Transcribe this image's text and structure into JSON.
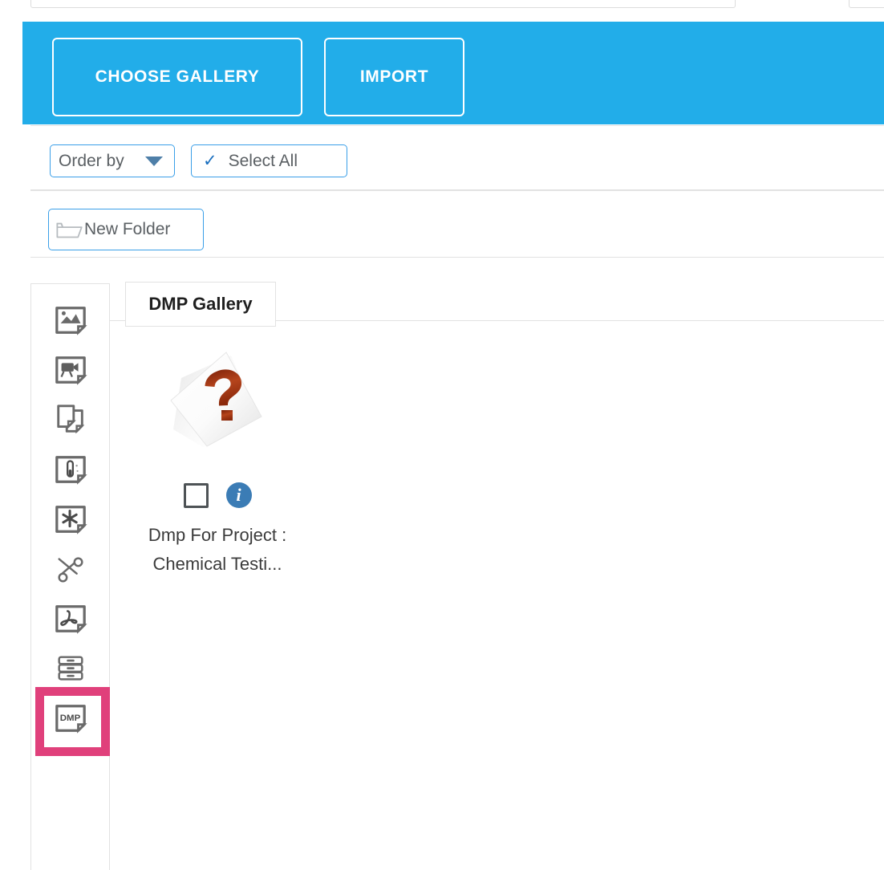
{
  "top_stubs": [
    {
      "name": "upper-field-left"
    },
    {
      "name": "upper-field-right"
    }
  ],
  "action_bar": {
    "background_color": "#22ADE9",
    "buttons": [
      {
        "label": "CHOOSE GALLERY",
        "name": "choose-gallery-button"
      },
      {
        "label": "IMPORT",
        "name": "import-button"
      }
    ]
  },
  "toolbar": {
    "order_by_label": "Order by",
    "select_all_label": "Select All",
    "select_all_check": "✓",
    "accent_color": "#3A9FE8"
  },
  "folder_bar": {
    "new_folder_label": "New Folder"
  },
  "sidebar": {
    "items": [
      {
        "label": "Images",
        "icon": "image-file-icon"
      },
      {
        "label": "Videos",
        "icon": "video-file-icon"
      },
      {
        "label": "Documents",
        "icon": "documents-icon"
      },
      {
        "label": "Chemistry",
        "icon": "test-tube-file-icon"
      },
      {
        "label": "Miscellaneous",
        "icon": "asterisk-file-icon"
      },
      {
        "label": "Snippets",
        "icon": "scissors-icon"
      },
      {
        "label": "PDF",
        "icon": "pdf-file-icon"
      },
      {
        "label": "Datasets",
        "icon": "database-icon"
      },
      {
        "label": "DMP",
        "icon": "dmp-file-icon",
        "selected": true
      }
    ],
    "selected_highlight_color": "#E0407B"
  },
  "gallery": {
    "tab_label": "DMP Gallery",
    "items": [
      {
        "name": "Dmp For Project : Chemical Testi...",
        "thumbnail": "unknown-file-question-mark",
        "info_glyph": "i",
        "checked": false
      }
    ]
  }
}
